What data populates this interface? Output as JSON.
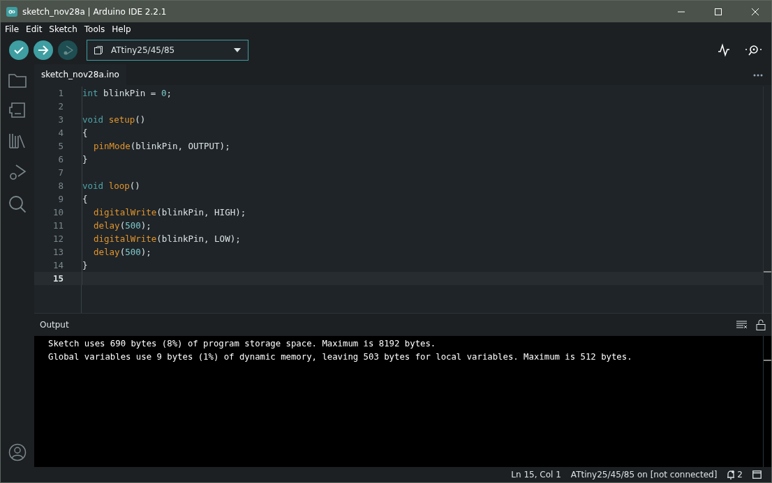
{
  "window": {
    "title": "sketch_nov28a | Arduino IDE 2.2.1"
  },
  "menu": [
    "File",
    "Edit",
    "Sketch",
    "Tools",
    "Help"
  ],
  "toolbar": {
    "board": "ATtiny25/45/85"
  },
  "tabs": [
    {
      "label": "sketch_nov28a.ino",
      "selected": true
    }
  ],
  "code": [
    {
      "number": "1",
      "current": false,
      "indent": false,
      "tokens": [
        {
          "kind": "keyword",
          "text": "int"
        },
        {
          "kind": "plain",
          "text": " blinkPin = "
        },
        {
          "kind": "number",
          "text": "0"
        },
        {
          "kind": "plain",
          "text": ";"
        }
      ]
    },
    {
      "number": "2",
      "current": false
    },
    {
      "number": "3",
      "current": false,
      "indent": false,
      "tokens": [
        {
          "kind": "keyword",
          "text": "void"
        },
        {
          "kind": "func",
          "text": " setup"
        },
        {
          "kind": "plain",
          "text": "()"
        }
      ]
    },
    {
      "number": "4",
      "current": false,
      "indent": false,
      "tokens": [
        {
          "kind": "plain",
          "text": "{"
        }
      ]
    },
    {
      "number": "5",
      "current": false,
      "indent": true,
      "tokens": [
        {
          "kind": "func",
          "text": "pinMode"
        },
        {
          "kind": "plain",
          "text": "(blinkPin, OUTPUT);"
        }
      ]
    },
    {
      "number": "6",
      "current": false,
      "indent": false,
      "tokens": [
        {
          "kind": "plain",
          "text": "}"
        }
      ]
    },
    {
      "number": "7",
      "current": false
    },
    {
      "number": "8",
      "current": false,
      "indent": false,
      "tokens": [
        {
          "kind": "keyword",
          "text": "void"
        },
        {
          "kind": "func",
          "text": " loop"
        },
        {
          "kind": "plain",
          "text": "()"
        }
      ]
    },
    {
      "number": "9",
      "current": false,
      "indent": false,
      "tokens": [
        {
          "kind": "plain",
          "text": "{"
        }
      ]
    },
    {
      "number": "10",
      "current": false,
      "indent": true,
      "tokens": [
        {
          "kind": "func",
          "text": "digitalWrite"
        },
        {
          "kind": "plain",
          "text": "(blinkPin, HIGH);"
        }
      ]
    },
    {
      "number": "11",
      "current": false,
      "indent": true,
      "tokens": [
        {
          "kind": "func",
          "text": "delay"
        },
        {
          "kind": "plain",
          "text": "("
        },
        {
          "kind": "number",
          "text": "500"
        },
        {
          "kind": "plain",
          "text": ");"
        }
      ]
    },
    {
      "number": "12",
      "current": false,
      "indent": true,
      "tokens": [
        {
          "kind": "func",
          "text": "digitalWrite"
        },
        {
          "kind": "plain",
          "text": "(blinkPin, LOW);"
        }
      ]
    },
    {
      "number": "13",
      "current": false,
      "indent": true,
      "tokens": [
        {
          "kind": "func",
          "text": "delay"
        },
        {
          "kind": "plain",
          "text": "("
        },
        {
          "kind": "number",
          "text": "500"
        },
        {
          "kind": "plain",
          "text": ");"
        }
      ]
    },
    {
      "number": "14",
      "current": false,
      "indent": false,
      "tokens": [
        {
          "kind": "plain",
          "text": "}"
        }
      ]
    },
    {
      "number": "15",
      "current": true
    }
  ],
  "output": {
    "title": "Output",
    "lines": [
      "Sketch uses 690 bytes (8%) of program storage space. Maximum is 8192 bytes.",
      "Global variables use 9 bytes (1%) of dynamic memory, leaving 503 bytes for local variables. Maximum is 512 bytes."
    ]
  },
  "status_bar": {
    "position": "Ln 15, Col 1",
    "board": "ATtiny25/45/85 on [not connected]",
    "notifications": "2"
  }
}
